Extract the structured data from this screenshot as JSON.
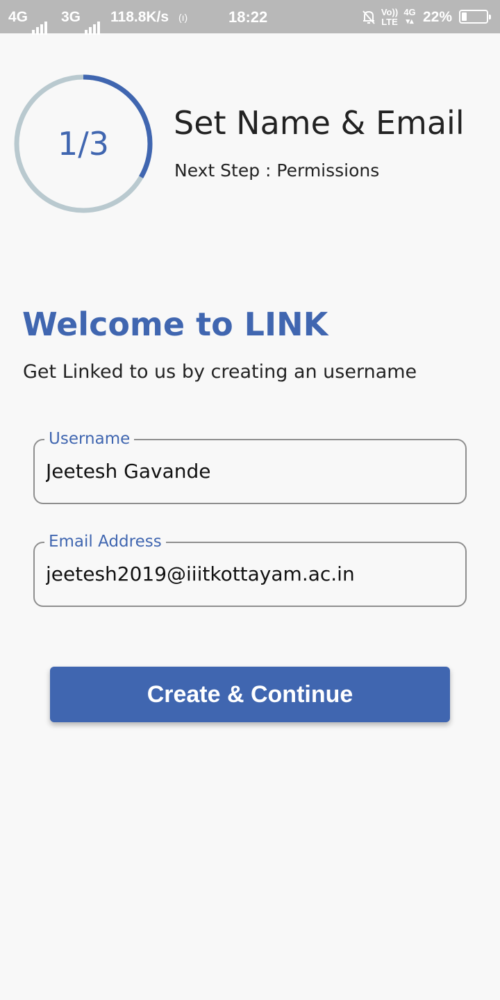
{
  "status_bar": {
    "network_1": "4G",
    "network_2": "3G",
    "speed": "118.8K/s",
    "hotspot_glyph": "(ı)",
    "time": "18:22",
    "volte_top": "Vo))",
    "volte_bottom": "LTE",
    "data_4g": "4G",
    "battery_percent": "22%",
    "battery_level": 0.22,
    "icons": [
      "signal-bars-icon",
      "hotspot-icon",
      "mute-notification-icon",
      "volte-icon",
      "data-arrows-icon",
      "battery-icon"
    ]
  },
  "progress": {
    "label": "1/3",
    "fraction": 0.3333,
    "track_color": "#b9c9cf",
    "arc_color": "#4066b0"
  },
  "step": {
    "title": "Set Name & Email",
    "next": "Next Step : Permissions"
  },
  "welcome": {
    "title": "Welcome to LINK",
    "subtitle": "Get Linked to us by creating an username"
  },
  "form": {
    "username_label": "Username",
    "username_value": "Jeetesh Gavande",
    "email_label": "Email Address",
    "email_value": "jeetesh2019@iiitkottayam.ac.in"
  },
  "cta": {
    "label": "Create & Continue"
  },
  "colors": {
    "accent": "#4066b0",
    "background": "#f8f8f8",
    "status_bar": "#b8b8b8"
  }
}
